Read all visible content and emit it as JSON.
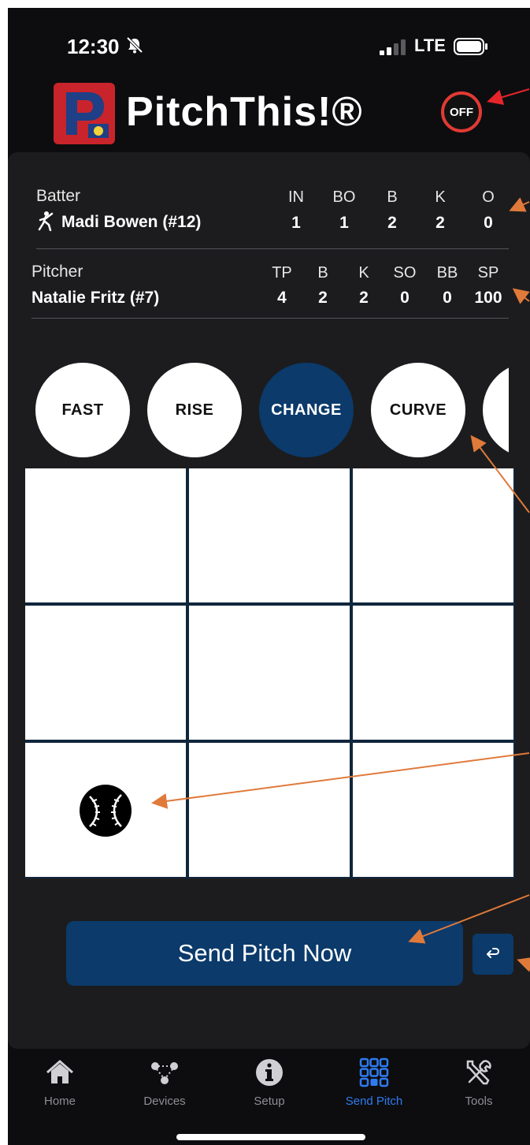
{
  "status_bar": {
    "time": "12:30",
    "network": "LTE"
  },
  "header": {
    "app_title": "PitchThis!®",
    "power_toggle_label": "OFF"
  },
  "batter": {
    "label": "Batter",
    "name": "Madi Bowen (#12)",
    "stats": [
      {
        "h": "IN",
        "v": "1"
      },
      {
        "h": "BO",
        "v": "1"
      },
      {
        "h": "B",
        "v": "2"
      },
      {
        "h": "K",
        "v": "2"
      },
      {
        "h": "O",
        "v": "0"
      }
    ]
  },
  "pitcher": {
    "label": "Pitcher",
    "name": "Natalie Fritz (#7)",
    "stats": [
      {
        "h": "TP",
        "v": "4"
      },
      {
        "h": "B",
        "v": "2"
      },
      {
        "h": "K",
        "v": "2"
      },
      {
        "h": "SO",
        "v": "0"
      },
      {
        "h": "BB",
        "v": "0"
      },
      {
        "h": "SP",
        "v": "100"
      }
    ]
  },
  "pitch_types": [
    {
      "label": "FAST",
      "selected": false
    },
    {
      "label": "RISE",
      "selected": false
    },
    {
      "label": "CHANGE",
      "selected": true
    },
    {
      "label": "CURVE",
      "selected": false
    },
    {
      "label": "",
      "selected": false
    }
  ],
  "zone_grid": {
    "rows": 3,
    "cols": 3,
    "selected_zone": 7
  },
  "actions": {
    "send_label": "Send Pitch Now",
    "undo_icon": "undo-icon"
  },
  "tabs": [
    {
      "label": "Home",
      "icon": "home-icon",
      "active": false
    },
    {
      "label": "Devices",
      "icon": "devices-icon",
      "active": false
    },
    {
      "label": "Setup",
      "icon": "info-icon",
      "active": false
    },
    {
      "label": "Send Pitch",
      "icon": "keypad-icon",
      "active": true
    },
    {
      "label": "Tools",
      "icon": "tools-icon",
      "active": false
    }
  ],
  "colors": {
    "accent": "#0b3a6b",
    "active_tab": "#2f7bf0",
    "toggle_ring": "#e23a34",
    "annotation_arrow": "#e07a3a"
  }
}
